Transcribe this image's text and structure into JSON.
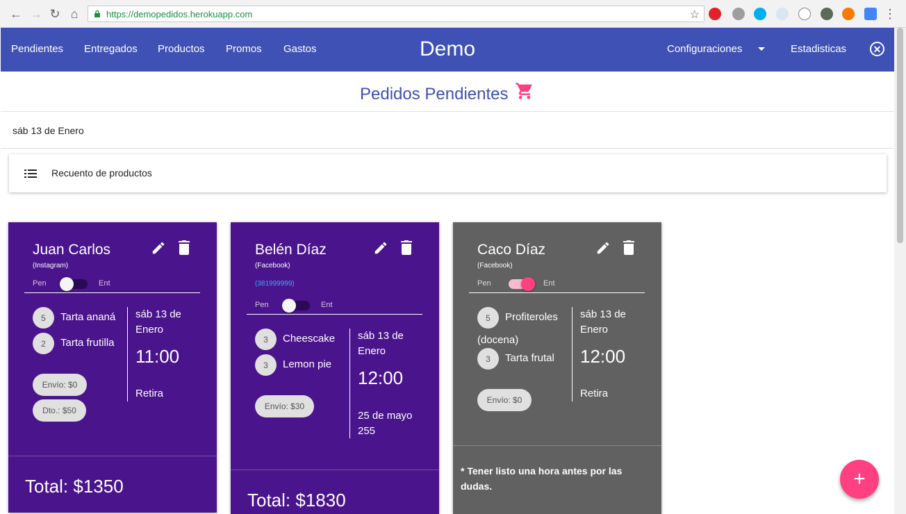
{
  "browser": {
    "url_host": "https://demopedidos.herokuapp.com",
    "back_icon": "←",
    "forward_icon": "→",
    "reload_icon": "↻",
    "home_icon": "⌂",
    "star_icon": "☆",
    "menu_icon": "⋮"
  },
  "appbar": {
    "nav": [
      "Pendientes",
      "Entregados",
      "Productos",
      "Promos",
      "Gastos"
    ],
    "brand": "Demo",
    "settings": "Configuraciones",
    "stats": "Estadisticas",
    "close_icon": "✕",
    "color": "#3f51b5"
  },
  "page": {
    "title": "Pedidos Pendientes",
    "date": "sáb 13 de Enero",
    "summary_label": "Recuento de productos"
  },
  "toggle_labels": {
    "pen": "Pen",
    "ent": "Ent"
  },
  "orders": [
    {
      "name": "Juan Carlos",
      "source": "(Instagram)",
      "phone": "",
      "delivered": false,
      "items": [
        {
          "qty": "5",
          "product": "Tarta ananá"
        },
        {
          "qty": "2",
          "product": "Tarta frutilla"
        }
      ],
      "date": "sáb 13 de Enero",
      "time": "11:00",
      "delivery": "Retira",
      "chips": [
        "Envío: $0",
        "Dto.: $50"
      ],
      "total": "Total: $1350",
      "note": ""
    },
    {
      "name": "Belén Díaz",
      "source": "(Facebook)",
      "phone": "(381999999)",
      "delivered": false,
      "items": [
        {
          "qty": "3",
          "product": "Cheescake"
        },
        {
          "qty": "3",
          "product": "Lemon pie"
        }
      ],
      "date": "sáb 13 de Enero",
      "time": "12:00",
      "delivery": "25 de mayo 255",
      "chips": [
        "Envío: $30"
      ],
      "total": "Total: $1830",
      "note": ""
    },
    {
      "name": "Caco Díaz",
      "source": "(Facebook)",
      "phone": "",
      "delivered": true,
      "items": [
        {
          "qty": "5",
          "product": "Profiteroles",
          "product_cont": "(docena)"
        },
        {
          "qty": "3",
          "product": "Tarta frutal"
        }
      ],
      "date": "sáb 13 de Enero",
      "time": "12:00",
      "delivery": "Retira",
      "chips": [
        "Envío: $0"
      ],
      "total": "",
      "note": "* Tener listo una hora antes por las dudas."
    }
  ],
  "fab": {
    "label": "+",
    "color": "#ff4081"
  },
  "colors": {
    "card_pending": "#4a148c",
    "card_delivered": "#616161",
    "accent": "#ff4081"
  }
}
